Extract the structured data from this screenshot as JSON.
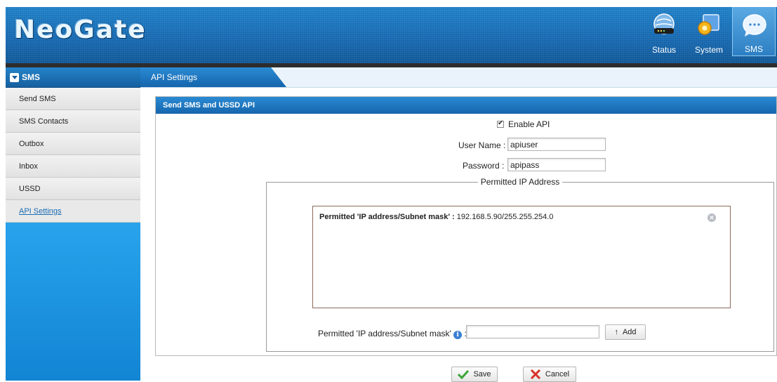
{
  "app": {
    "logo_text": "NeoGate"
  },
  "topnav": [
    {
      "label": "Status",
      "icon": "status-globe-icon"
    },
    {
      "label": "System",
      "icon": "system-gear-icon"
    },
    {
      "label": "SMS",
      "icon": "sms-chat-icon",
      "active": true
    }
  ],
  "sidebar": {
    "heading": "SMS",
    "items": [
      {
        "label": "Send SMS"
      },
      {
        "label": "SMS Contacts"
      },
      {
        "label": "Outbox"
      },
      {
        "label": "Inbox"
      },
      {
        "label": "USSD"
      },
      {
        "label": "API Settings",
        "active": true
      }
    ]
  },
  "tab": {
    "label": "API Settings"
  },
  "panel": {
    "title": "Send SMS and USSD API",
    "enable_api_label": "Enable API",
    "enable_api_checked": true,
    "username_label": "User Name :",
    "username_value": "apiuser",
    "password_label": "Password :",
    "password_value": "apipass",
    "permitted_legend": "Permitted IP Address",
    "permitted_entry_label": "Permitted 'IP address/Subnet mask' :",
    "permitted_entry_value": "192.168.5.90/255.255.254.0",
    "add_field_label": "Permitted 'IP address/Subnet mask'",
    "add_field_colon": ":",
    "add_field_value": "",
    "add_button_glyph": "↑",
    "add_button_label": "Add"
  },
  "actions": {
    "save_label": "Save",
    "cancel_label": "Cancel"
  },
  "colors": {
    "brand_blue": "#1566ae",
    "sidebar_blue": "#1a8fd9",
    "link_blue": "#1a6bb3"
  }
}
